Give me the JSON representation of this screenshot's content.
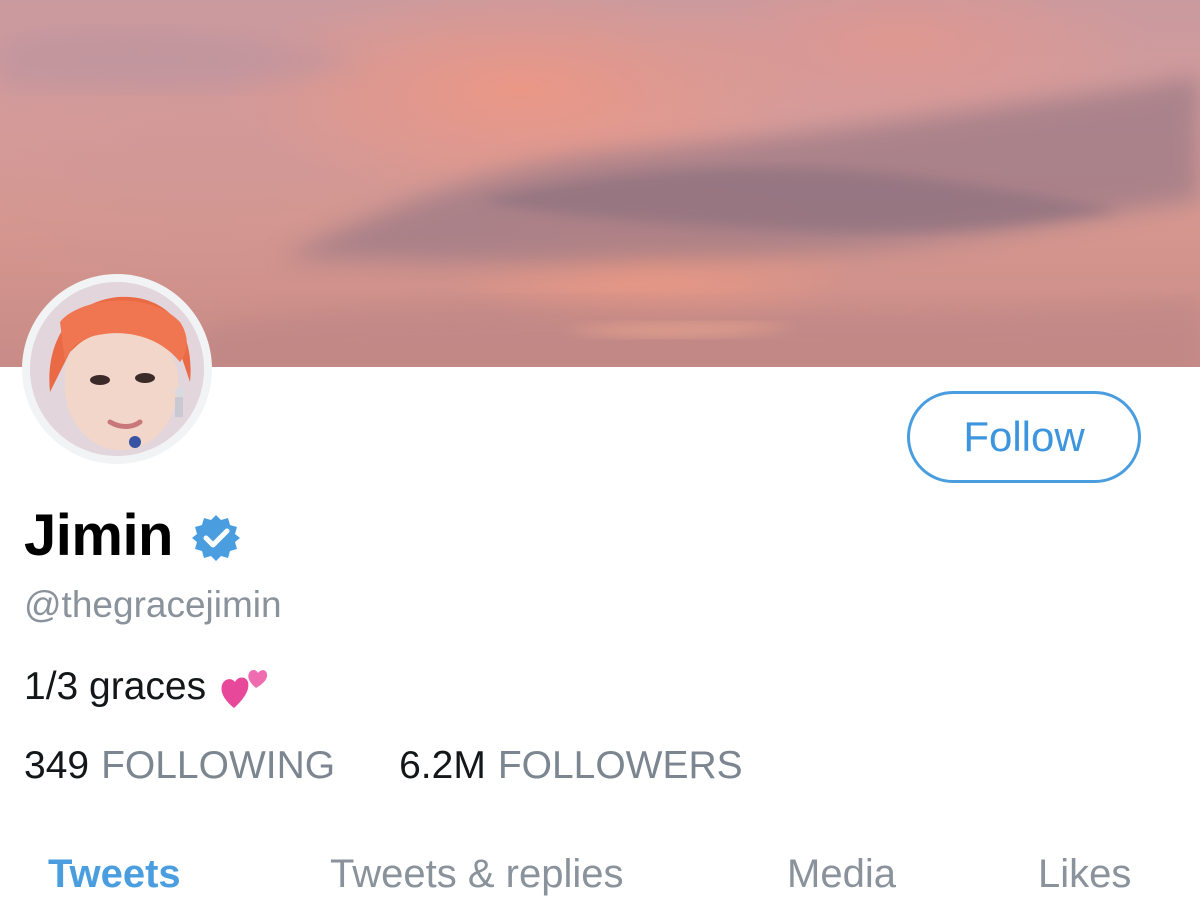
{
  "profile": {
    "display_name": "Jimin",
    "handle": "@thegracejimin",
    "bio": "1/3 graces",
    "verified_icon": "verified-badge-icon",
    "bio_emoji_icon": "two-hearts-icon"
  },
  "actions": {
    "follow_label": "Follow"
  },
  "stats": {
    "following_count": "349",
    "following_label": "FOLLOWING",
    "followers_count": "6.2M",
    "followers_label": "FOLLOWERS"
  },
  "tabs": [
    {
      "label": "Tweets",
      "active": true
    },
    {
      "label": "Tweets & replies",
      "active": false
    },
    {
      "label": "Media",
      "active": false
    },
    {
      "label": "Likes",
      "active": false
    }
  ],
  "colors": {
    "accent": "#4a9ee0",
    "muted": "#8a929b"
  }
}
